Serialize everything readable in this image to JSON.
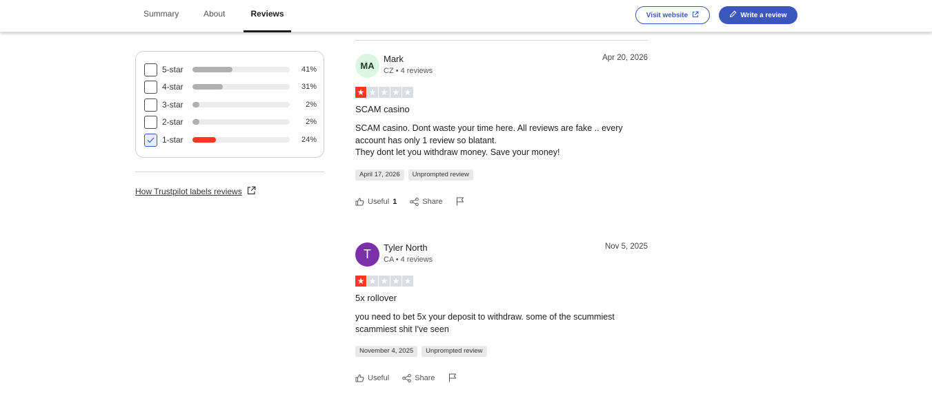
{
  "nav": {
    "tabs": [
      {
        "label": "Summary",
        "active": false
      },
      {
        "label": "About",
        "active": false
      },
      {
        "label": "Reviews",
        "active": true
      }
    ],
    "visit_website_label": "Visit website",
    "write_review_label": "Write a review",
    "accent_color": "#3c57bc"
  },
  "filter": {
    "rows": [
      {
        "label": "5-star",
        "percent_text": "41%",
        "percent": 41,
        "checked": false
      },
      {
        "label": "4-star",
        "percent_text": "31%",
        "percent": 31,
        "checked": false
      },
      {
        "label": "3-star",
        "percent_text": "2%",
        "percent": 2,
        "checked": false
      },
      {
        "label": "2-star",
        "percent_text": "2%",
        "percent": 2,
        "checked": false
      },
      {
        "label": "1-star",
        "percent_text": "24%",
        "percent": 24,
        "checked": true
      }
    ],
    "labels_link": "How Trustpilot labels reviews"
  },
  "reviews": [
    {
      "avatar_initials": "MA",
      "name": "Mark",
      "meta": "CZ • 4 reviews",
      "date": "Apr 20, 2026",
      "rating": 1,
      "title": "SCAM casino",
      "body_lines": [
        "SCAM casino. Dont waste your time here. All reviews are fake .. every account has only 1 review so blatant.",
        "They dont let you withdraw money. Save your money!"
      ],
      "experience_date": "April 17, 2026",
      "tag": "Unprompted review",
      "useful_label": "Useful",
      "useful_count": "1",
      "share_label": "Share"
    },
    {
      "avatar_initials": "T",
      "name": "Tyler North",
      "meta": "CA • 4 reviews",
      "date": "Nov 5, 2025",
      "rating": 1,
      "title": "5x rollover",
      "body_lines": [
        "you need to bet 5x your deposit to withdraw. some of the scummiest scammiest shit I've seen"
      ],
      "experience_date": "November 4, 2025",
      "tag": "Unprompted review",
      "useful_label": "Useful",
      "useful_count": "",
      "share_label": "Share"
    }
  ],
  "colors": {
    "star_on": "#ff3722",
    "star_off": "#dcdce6",
    "bar_red": "#ff3722",
    "bar_gray": "#b0b0b0"
  }
}
